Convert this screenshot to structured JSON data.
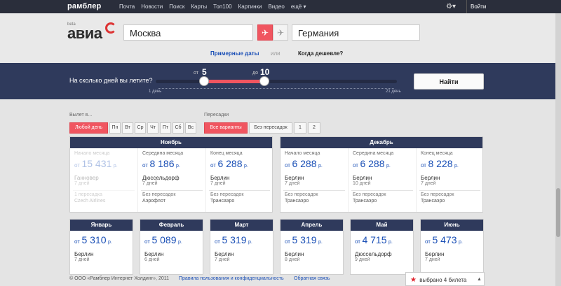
{
  "topbar": {
    "logo": "рамблер",
    "nav": [
      "Почта",
      "Новости",
      "Поиск",
      "Карты",
      "Топ100",
      "Картинки",
      "Видео",
      "ещё ▾"
    ],
    "login": "Войти"
  },
  "brand": {
    "beta": "beta",
    "name": "авиа"
  },
  "search": {
    "from": "Москва",
    "to": "Германия"
  },
  "modes": {
    "dates": "Примерные даты",
    "or": "или",
    "cheaper": "Когда дешевле?"
  },
  "duration": {
    "question": "На сколько дней вы летите?",
    "from_label": "от",
    "from_value": "5",
    "to_label": "до",
    "to_value": "10",
    "min_label": "1 день",
    "max_label": "21 день",
    "find": "Найти"
  },
  "filters": {
    "weekday_label": "Вылет в...",
    "weekdays": [
      "Любой день",
      "Пн",
      "Вт",
      "Ср",
      "Чт",
      "Пт",
      "Сб",
      "Вс"
    ],
    "stops_label": "Пересадки",
    "stops": [
      "Все варианты",
      "Без пересадок",
      "1",
      "2"
    ]
  },
  "months_top": [
    {
      "name": "Ноябрь",
      "cols": [
        {
          "title": "Начало месяца",
          "ot": "от",
          "price": "15 431",
          "r": "р.",
          "city": "Ганновер",
          "days": "7 дней",
          "stops": "1 пересадка",
          "airline": "Czech Airlines",
          "faded": true
        },
        {
          "title": "Середина месяца",
          "ot": "от",
          "price": "8 186",
          "r": "р.",
          "city": "Дюссельдорф",
          "days": "7 дней",
          "stops": "Без пересадок",
          "airline": "Аэрофлот",
          "faded": false
        },
        {
          "title": "Конец месяца",
          "ot": "от",
          "price": "6 288",
          "r": "р.",
          "city": "Берлин",
          "days": "7 дней",
          "stops": "Без пересадок",
          "airline": "Трансаэро",
          "faded": false
        }
      ]
    },
    {
      "name": "Декабрь",
      "cols": [
        {
          "title": "Начало месяца",
          "ot": "от",
          "price": "6 288",
          "r": "р.",
          "city": "Берлин",
          "days": "7 дней",
          "stops": "Без пересадок",
          "airline": "Трансаэро",
          "faded": false
        },
        {
          "title": "Середина месяца",
          "ot": "от",
          "price": "6 288",
          "r": "р.",
          "city": "Берлин",
          "days": "10 дней",
          "stops": "Без пересадок",
          "airline": "Трансаэро",
          "faded": false
        },
        {
          "title": "Конец месяца",
          "ot": "от",
          "price": "8 228",
          "r": "р.",
          "city": "Берлин",
          "days": "7 дней",
          "stops": "Без пересадок",
          "airline": "Трансаэро",
          "faded": false
        }
      ]
    }
  ],
  "months_bottom": [
    {
      "name": "Январь",
      "ot": "от",
      "price": "5 310",
      "r": "р.",
      "city": "Берлин",
      "days": "7 дней"
    },
    {
      "name": "Февраль",
      "ot": "от",
      "price": "5 089",
      "r": "р.",
      "city": "Берлин",
      "days": "6 дней"
    },
    {
      "name": "Март",
      "ot": "от",
      "price": "5 319",
      "r": "р.",
      "city": "Берлин",
      "days": "7 дней"
    },
    {
      "name": "Апрель",
      "ot": "от",
      "price": "5 319",
      "r": "р.",
      "city": "Берлин",
      "days": "8 дней"
    },
    {
      "name": "Май",
      "ot": "от",
      "price": "4 715",
      "r": "р.",
      "city": "Дюссельдорф",
      "days": "9 дней"
    },
    {
      "name": "Июнь",
      "ot": "от",
      "price": "5 473",
      "r": "р.",
      "city": "Берлин",
      "days": "7 дней"
    }
  ],
  "footer": {
    "copyright": "© ООО «Рамблер Интернет Холдинг», 2011",
    "terms": "Правила пользования и конфиденциальность",
    "feedback": "Обратная связь"
  },
  "selection": {
    "text": "выбрано 4 билета",
    "caret": "▲"
  },
  "colors": {
    "navy": "#2f3a5c",
    "accent": "#f05560",
    "price": "#1a4fb6"
  }
}
